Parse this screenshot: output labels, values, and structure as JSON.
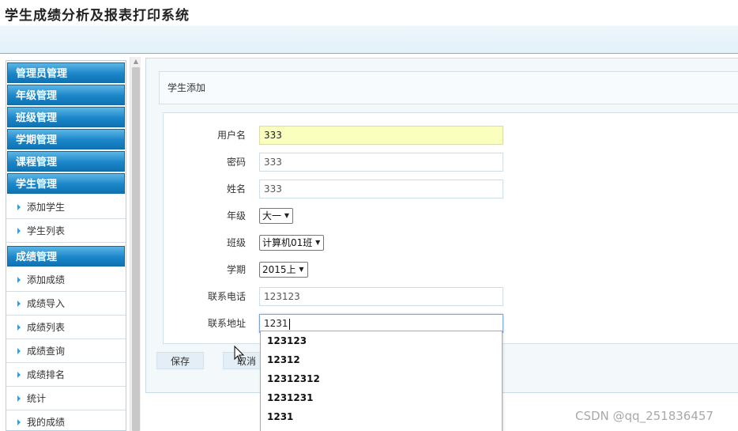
{
  "app": {
    "title": "学生成绩分析及报表打印系统"
  },
  "sidebar": {
    "groups": [
      {
        "label": "管理员管理",
        "items": []
      },
      {
        "label": "年级管理",
        "items": []
      },
      {
        "label": "班级管理",
        "items": []
      },
      {
        "label": "学期管理",
        "items": []
      },
      {
        "label": "课程管理",
        "items": []
      },
      {
        "label": "学生管理",
        "items": [
          "添加学生",
          "学生列表"
        ]
      },
      {
        "label": "成绩管理",
        "items": [
          "添加成绩",
          "成绩导入",
          "成绩列表",
          "成绩查询",
          "成绩排名",
          "统计",
          "我的成绩"
        ]
      }
    ]
  },
  "panel": {
    "title": "学生添加"
  },
  "form": {
    "username": {
      "label": "用户名",
      "value": "333"
    },
    "password": {
      "label": "密码",
      "value": "333"
    },
    "name": {
      "label": "姓名",
      "value": "333"
    },
    "grade": {
      "label": "年级",
      "selected": "大一"
    },
    "class": {
      "label": "班级",
      "selected": "计算机01班"
    },
    "semester": {
      "label": "学期",
      "selected": "2015上"
    },
    "phone": {
      "label": "联系电话",
      "value": "123123"
    },
    "address": {
      "label": "联系地址",
      "value": "1231"
    }
  },
  "buttons": {
    "save": "保存",
    "cancel": "取消"
  },
  "autocomplete": {
    "options": [
      "123123",
      "12312",
      "12312312",
      "1231231",
      "1231"
    ]
  },
  "watermark": "CSDN @qq_251836457",
  "colors": {
    "accent": "#1b86c8",
    "autofill": "#faffbd"
  }
}
